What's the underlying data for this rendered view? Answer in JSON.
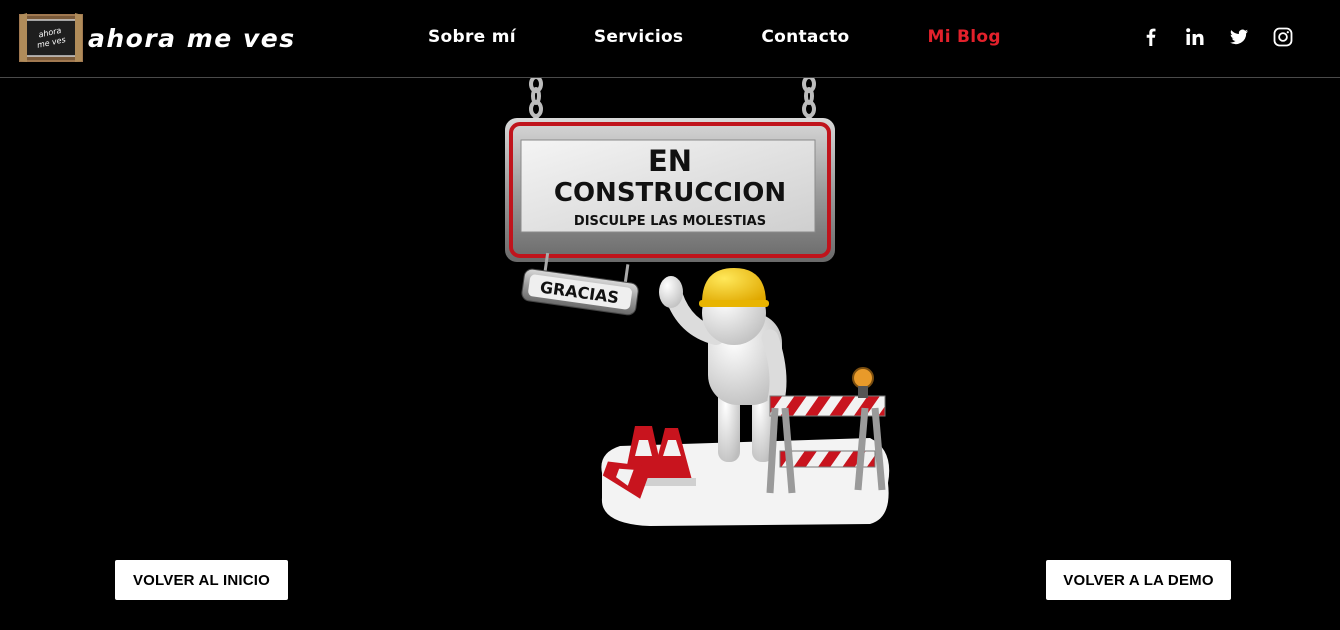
{
  "brand": {
    "name": "ahora me ves",
    "badge_text_1": "ahora",
    "badge_text_2": "me ves"
  },
  "nav": {
    "items": [
      {
        "label": "Sobre mí"
      },
      {
        "label": "Servicios"
      },
      {
        "label": "Contacto"
      },
      {
        "label": "Mi Blog",
        "active": true
      }
    ],
    "active_color": "#e3212b"
  },
  "social": [
    "facebook-icon",
    "linkedin-icon",
    "twitter-icon",
    "instagram-icon"
  ],
  "sign": {
    "line1": "EN",
    "line2": "CONSTRUCCION",
    "line3": "DISCULPE LAS MOLESTIAS",
    "tag": "GRACIAS"
  },
  "buttons": {
    "left": "VOLVER AL INICIO",
    "right": "VOLVER A LA DEMO"
  }
}
